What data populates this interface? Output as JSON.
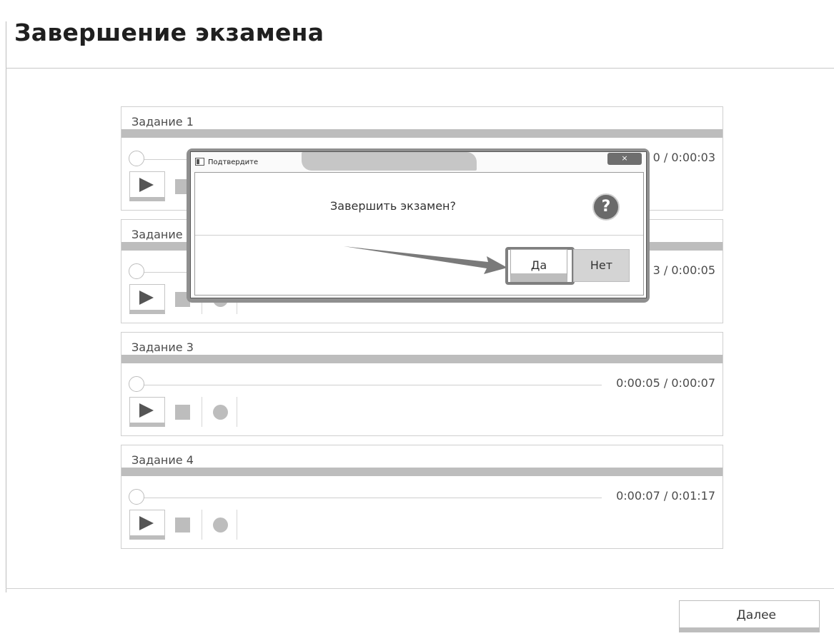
{
  "page": {
    "title": "Завершение экзамена"
  },
  "tasks": [
    {
      "title": "Задание 1",
      "time": "0:00:00 / 0:00:03",
      "time_visible": "0 / 0:00:03"
    },
    {
      "title": "Задание 2",
      "title_visible": "Задание",
      "time": "0:00:03 / 0:00:05",
      "time_visible": "3 / 0:00:05"
    },
    {
      "title": "Задание 3",
      "time": "0:00:05 / 0:00:07"
    },
    {
      "title": "Задание 4",
      "time": "0:00:07 / 0:01:17"
    }
  ],
  "icons": {
    "play": "play-icon",
    "stop": "stop-icon",
    "record": "record-icon",
    "help": "help-icon",
    "close": "close-icon"
  },
  "dialog": {
    "title": "Подтвердите",
    "close_label": "×",
    "message": "Завершить экзамен?",
    "help_glyph": "?",
    "yes_label": "Да",
    "no_label": "Нет"
  },
  "footer": {
    "next_label": "Далее"
  }
}
